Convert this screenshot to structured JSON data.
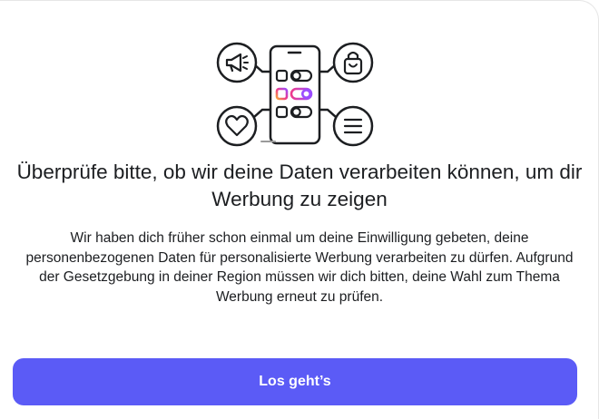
{
  "dialog": {
    "title": "Überprüfe bitte, ob wir deine Daten verarbeiten können, um dir Werbung zu zeigen",
    "description": "Wir haben dich früher schon einmal um deine Einwilligung gebeten, deine personenbezogenen Daten für personalisierte Werbung verarbeiten zu dürfen. Aufgrund der Gesetzgebung in deiner Region müssen wir dich bitten, deine Wahl zum Thema Werbung erneut zu prüfen.",
    "primary_button_label": "Los geht’s"
  },
  "illustration": {
    "icons": [
      "megaphone-icon",
      "shopping-bag-icon",
      "heart-icon",
      "menu-lines-icon",
      "phone-icon",
      "toggle-icon"
    ],
    "colors": {
      "stroke": "#1c1e21",
      "accent_pink": "#ee3a8c",
      "accent_purple": "#9b4dff",
      "accent_orange": "#f7a33a"
    }
  },
  "colors": {
    "button_background": "#5b5bf6",
    "button_text": "#ffffff",
    "text": "#1c1e21",
    "background": "#ffffff"
  }
}
